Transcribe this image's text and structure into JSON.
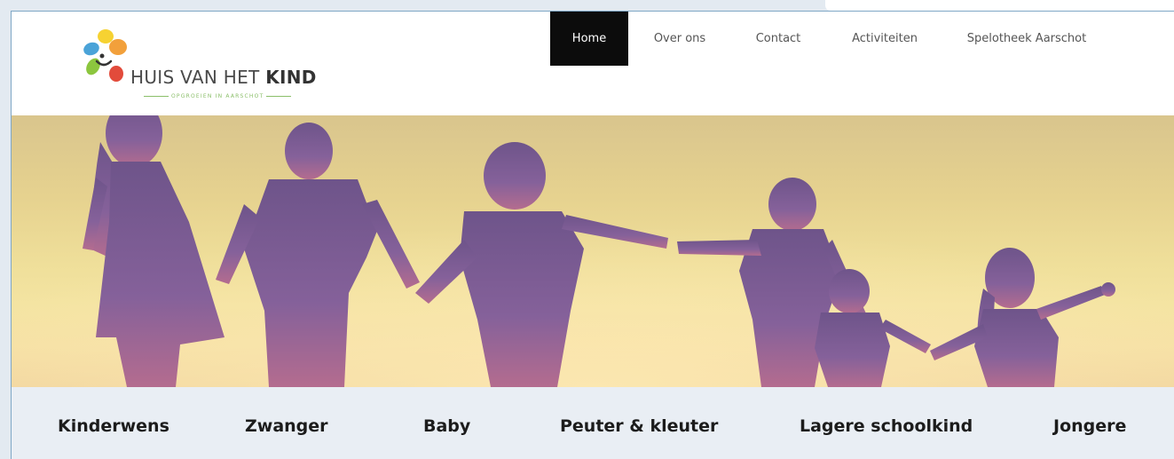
{
  "brand": {
    "name_light": "HUIS VAN HET ",
    "name_bold": "KIND",
    "tagline": "OPGROEIEN IN AARSCHOT",
    "colors": [
      "#f2a03b",
      "#f6d232",
      "#4aa3d8",
      "#8cc63e",
      "#e24b3b",
      "#6b4aa0"
    ]
  },
  "nav": {
    "items": [
      {
        "label": "Home",
        "active": true
      },
      {
        "label": "Over ons"
      },
      {
        "label": "Contact"
      },
      {
        "label": "Activiteiten"
      },
      {
        "label": "Spelotheek Aarschot"
      }
    ]
  },
  "categories": [
    {
      "label": "Kinderwens"
    },
    {
      "label": "Zwanger"
    },
    {
      "label": "Baby"
    },
    {
      "label": "Peuter & kleuter"
    },
    {
      "label": "Lagere schoolkind"
    },
    {
      "label": "Jongere"
    }
  ],
  "colors": {
    "nav_active_bg": "#0c0c0c",
    "category_bar_bg": "#e9eef4",
    "silhouette": "#7b5a8c"
  }
}
